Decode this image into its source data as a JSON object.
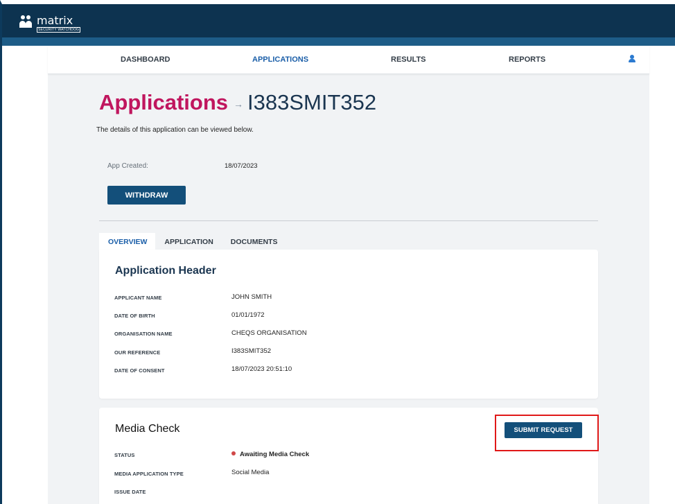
{
  "brand": {
    "name": "matrix",
    "tagline": "SECURITY WATCHDOG"
  },
  "nav": {
    "items": [
      {
        "label": "DASHBOARD"
      },
      {
        "label": "APPLICATIONS"
      },
      {
        "label": "RESULTS"
      },
      {
        "label": "REPORTS"
      }
    ],
    "active": "APPLICATIONS"
  },
  "heading": {
    "section": "Applications",
    "arrow": "→",
    "id": "I383SMIT352"
  },
  "intro": "The details of this application can be viewed below.",
  "app_created": {
    "label": "App Created:",
    "value": "18/07/2023"
  },
  "withdraw_label": "WITHDRAW",
  "tabs": [
    {
      "label": "OVERVIEW"
    },
    {
      "label": "APPLICATION"
    },
    {
      "label": "DOCUMENTS"
    }
  ],
  "active_tab": "OVERVIEW",
  "application_header": {
    "title": "Application Header",
    "fields": [
      {
        "label": "APPLICANT NAME",
        "value": "JOHN SMITH"
      },
      {
        "label": "DATE OF BIRTH",
        "value": "01/01/1972"
      },
      {
        "label": "ORGANISATION NAME",
        "value": "CHEQS ORGANISATION"
      },
      {
        "label": "OUR REFERENCE",
        "value": "I383SMIT352"
      },
      {
        "label": "DATE OF CONSENT",
        "value": "18/07/2023 20:51:10"
      }
    ]
  },
  "media_check": {
    "title": "Media Check",
    "submit_label": "SUBMIT REQUEST",
    "fields": [
      {
        "label": "STATUS",
        "value": "Awaiting Media Check"
      },
      {
        "label": "MEDIA APPLICATION TYPE",
        "value": "Social Media"
      },
      {
        "label": "ISSUE DATE",
        "value": ""
      }
    ]
  },
  "colors": {
    "header_bg": "#0d3350",
    "accent": "#c0165e",
    "primary_button": "#134f7a",
    "active_link": "#1a5ea8",
    "status_dot": "#d04848",
    "highlight": "#e01818"
  }
}
